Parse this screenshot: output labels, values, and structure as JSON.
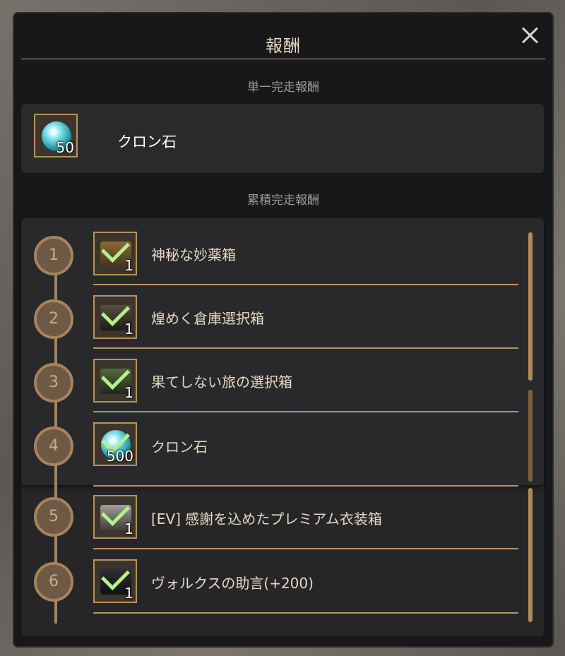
{
  "dialog": {
    "title": "報酬"
  },
  "single": {
    "label": "単一完走報酬",
    "item": {
      "name": "クロン石",
      "qty": "50",
      "icon": "cron-stone-icon"
    }
  },
  "cumulative": {
    "label": "累積完走報酬",
    "items": [
      {
        "step": "1",
        "name": "神秘な妙薬箱",
        "qty": "1",
        "icon": "mysterious-elixir-box-icon",
        "claimed": true
      },
      {
        "step": "2",
        "name": "煌めく倉庫選択箱",
        "qty": "1",
        "icon": "glittering-storage-box-icon",
        "claimed": true
      },
      {
        "step": "3",
        "name": "果てしない旅の選択箱",
        "qty": "1",
        "icon": "endless-journey-box-icon",
        "claimed": true
      },
      {
        "step": "4",
        "name": "クロン石",
        "qty": "500",
        "icon": "cron-stone-icon",
        "claimed": true
      },
      {
        "step": "5",
        "name": "[EV] 感謝を込めたプレミアム衣装箱",
        "qty": "1",
        "icon": "premium-outfit-box-icon",
        "claimed": true
      },
      {
        "step": "6",
        "name": "ヴォルクスの助言(+200)",
        "qty": "1",
        "icon": "valks-advice-icon",
        "claimed": true
      }
    ]
  },
  "colors": {
    "accent": "#b79466",
    "panel": "#18181b",
    "check": "#b7f08b"
  }
}
